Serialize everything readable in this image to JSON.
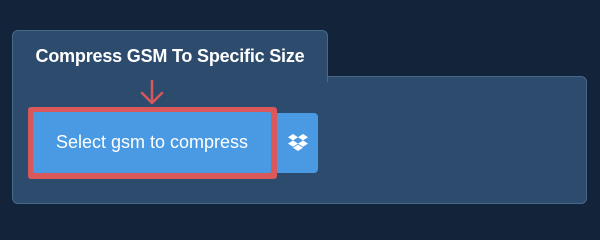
{
  "tab": {
    "title": "Compress GSM To Specific Size"
  },
  "select_button": {
    "label": "Select gsm to compress"
  },
  "dropbox_button": {
    "icon": "dropbox-icon"
  },
  "colors": {
    "background": "#13233a",
    "panel": "#2d4b6c",
    "button": "#4a9ae3",
    "highlight": "#d9585a"
  }
}
